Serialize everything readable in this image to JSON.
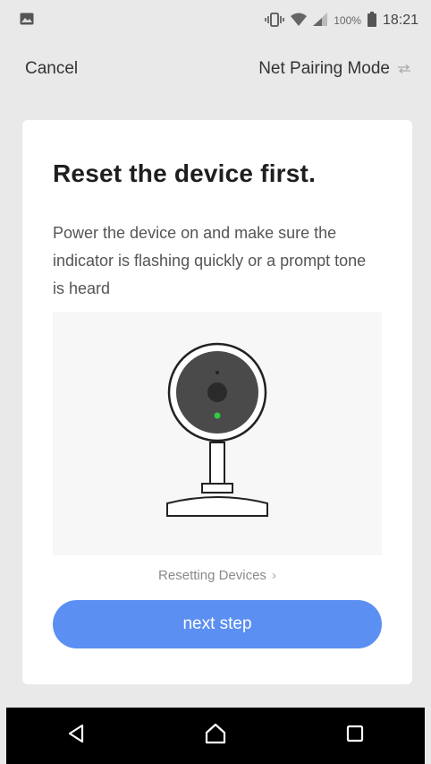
{
  "status_bar": {
    "battery_text": "100%",
    "time": "18:21",
    "icons": [
      "image-icon",
      "vibrate-icon",
      "wifi-icon",
      "signal-icon",
      "battery-icon"
    ]
  },
  "header": {
    "cancel_label": "Cancel",
    "mode_label": "Net Pairing Mode",
    "mode_icon": "swap-icon"
  },
  "card": {
    "title": "Reset the device first.",
    "description": "Power the device on and make sure the indicator is flashing quickly or a prompt tone is heard",
    "illustration": "camera-illustration",
    "indicator_color": "#2ecc40",
    "reset_link_label": "Resetting Devices",
    "next_button_label": "next step"
  },
  "nav_bar": {
    "items": [
      "back-icon",
      "home-icon",
      "recents-icon"
    ]
  },
  "colors": {
    "background": "#e9e9e9",
    "card": "#ffffff",
    "accent": "#5b8ff2",
    "nav_bar": "#000000"
  }
}
